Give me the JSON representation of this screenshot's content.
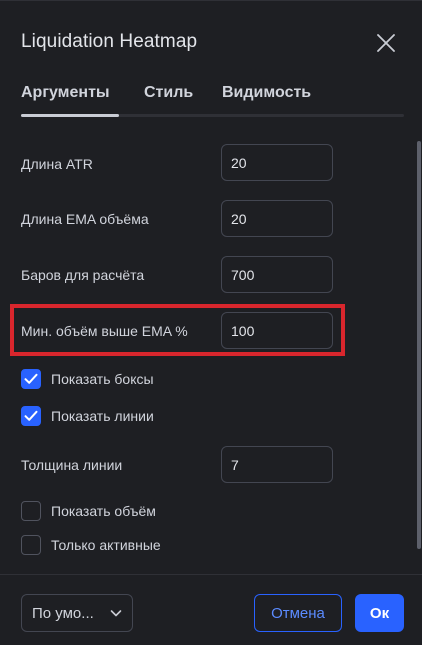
{
  "dialog": {
    "title": "Liquidation Heatmap"
  },
  "tabs": [
    {
      "label": "Аргументы",
      "active": true
    },
    {
      "label": "Стиль",
      "active": false
    },
    {
      "label": "Видимость",
      "active": false
    }
  ],
  "fields": {
    "atr_length": {
      "label": "Длина ATR",
      "value": "20"
    },
    "ema_volume_length": {
      "label": "Длина EMA объёма",
      "value": "20"
    },
    "bars_for_calc": {
      "label": "Баров для расчёта",
      "value": "700"
    },
    "min_volume_above_ema": {
      "label": "Мин. объём выше EMA %",
      "value": "100"
    },
    "line_width": {
      "label": "Толщина линии",
      "value": "7"
    }
  },
  "checkboxes": {
    "show_boxes": {
      "label": "Показать боксы",
      "checked": true
    },
    "show_lines": {
      "label": "Показать линии",
      "checked": true
    },
    "show_volume": {
      "label": "Показать объём",
      "checked": false
    },
    "only_active": {
      "label": "Только активные",
      "checked": false
    }
  },
  "footer": {
    "defaults_label": "По умо...",
    "cancel_label": "Отмена",
    "ok_label": "Ок"
  },
  "icons": {
    "close": "close-icon",
    "check": "checkmark-icon",
    "chevron": "chevron-down-icon"
  },
  "colors": {
    "background": "#1e1f23",
    "accent": "#2962ff",
    "highlight": "#d9262d",
    "text": "#d1d4dc"
  }
}
